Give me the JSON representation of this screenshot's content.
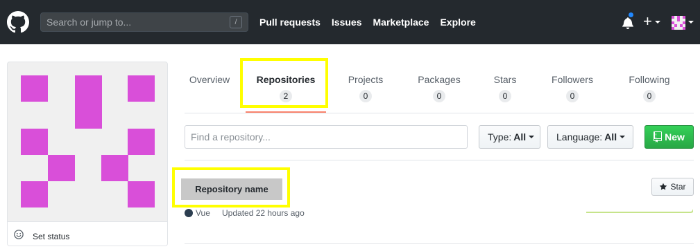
{
  "header": {
    "search_placeholder": "Search or jump to...",
    "search_hint": "/",
    "nav": [
      "Pull requests",
      "Issues",
      "Marketplace",
      "Explore"
    ],
    "plus": "+"
  },
  "profile": {
    "set_status": "Set status",
    "identicon_color": "#d94fd9"
  },
  "tabs": [
    {
      "label": "Overview",
      "count": null
    },
    {
      "label": "Repositories",
      "count": "2"
    },
    {
      "label": "Projects",
      "count": "0"
    },
    {
      "label": "Packages",
      "count": "0"
    },
    {
      "label": "Stars",
      "count": "0"
    },
    {
      "label": "Followers",
      "count": "0"
    },
    {
      "label": "Following",
      "count": "0"
    }
  ],
  "filters": {
    "find_placeholder": "Find a repository...",
    "type_label": "Type:",
    "type_value": "All",
    "language_label": "Language:",
    "language_value": "All",
    "new_label": "New"
  },
  "repo": {
    "name": "Repository name",
    "language": "Vue",
    "language_color": "#2c3e50",
    "updated": "Updated 22 hours ago",
    "star_label": "Star"
  },
  "colors": {
    "highlight": "#ffff00",
    "header_bg": "#24292e",
    "new_button": "#28a745"
  }
}
